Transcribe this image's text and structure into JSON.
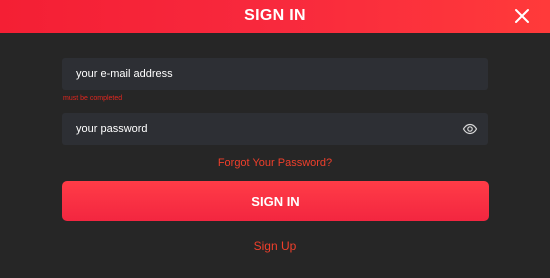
{
  "header": {
    "title": "SIGN IN",
    "close_icon": "close-icon"
  },
  "form": {
    "email": {
      "value": "",
      "placeholder": "your e-mail address",
      "error": "must be completed"
    },
    "password": {
      "value": "",
      "placeholder": "your password",
      "toggle_icon": "eye-icon"
    },
    "forgot_label": "Forgot Your Password?",
    "submit_label": "SIGN IN",
    "signup_label": "Sign Up"
  },
  "colors": {
    "accent": "#f41f34",
    "link": "#f03f2b",
    "error": "#e2261f",
    "background": "#262626",
    "field": "#2d2f34"
  }
}
